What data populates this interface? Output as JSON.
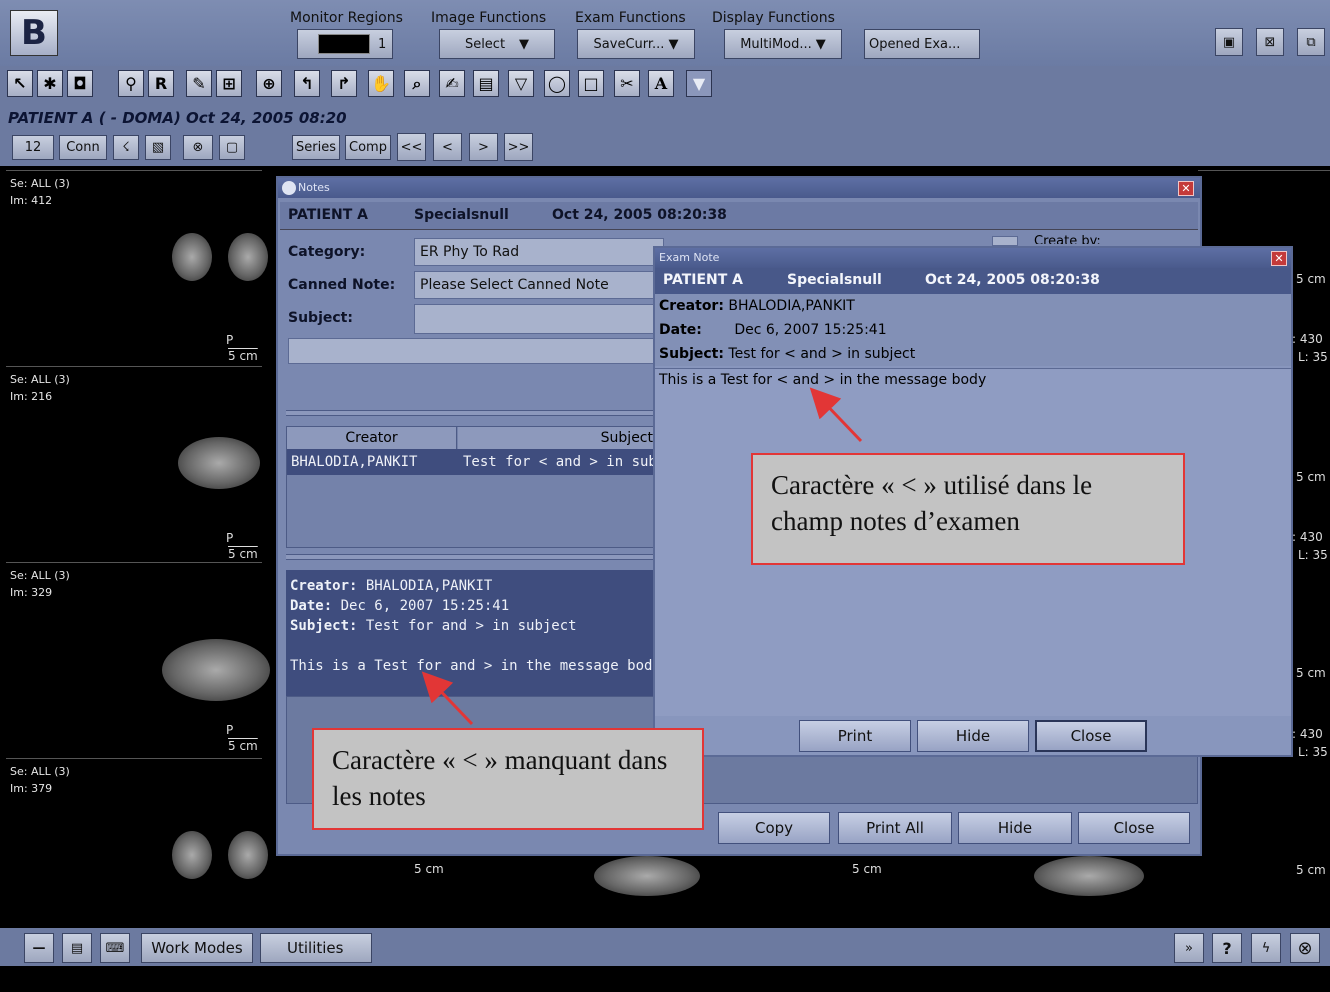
{
  "app": {
    "logo": "B"
  },
  "menus": [
    "Monitor Regions",
    "Image Functions",
    "Exam Functions",
    "Display Functions"
  ],
  "menu_controls": {
    "region_value": "1",
    "image_select": "Select",
    "exam_save": "SaveCurr...",
    "display_mode": "MultiMod...",
    "opened": "Opened Exa..."
  },
  "toolbar_labels": {
    "r": "R",
    "a": "A"
  },
  "patient_header": "PATIENT A ( - DOMA) Oct 24, 2005 08:20",
  "subtoolbar": {
    "count": "12",
    "conn": "Conn",
    "series": "Series",
    "comp": "Comp",
    "first": "<<",
    "prev": "<",
    "next": ">",
    "last": ">>"
  },
  "viewports": [
    {
      "se": "Se: ALL (3)",
      "im": "Im: 412",
      "scale": "5 cm",
      "p": "P"
    },
    {
      "se": "Se: ALL (3)",
      "im": "Im: 216",
      "scale": "5 cm",
      "p": "P"
    },
    {
      "se": "Se: ALL (3)",
      "im": "Im: 329",
      "scale": "5 cm",
      "p": "P"
    },
    {
      "se": "Se: ALL (3)",
      "im": "Im: 379",
      "scale": "5 cm",
      "p": "P"
    }
  ],
  "right_vp": {
    "scale": "5 cm",
    "w": ": 430",
    "l": "L: 35",
    "lmark": "L"
  },
  "notes": {
    "title": "Notes",
    "header": {
      "patient": "PATIENT A",
      "special": "Specialsnull",
      "date": "Oct 24, 2005 08:20:38"
    },
    "category_label": "Category:",
    "category_value": "ER Phy To Rad",
    "canned_label": "Canned Note:",
    "canned_value": "Please Select Canned Note",
    "subject_label": "Subject:",
    "create_by": "Create by:",
    "table_headers": [
      "Creator",
      "Subject"
    ],
    "row": {
      "creator": "BHALODIA,PANKIT",
      "subject": "Test  for < and > in sub"
    },
    "detail": {
      "creator_label": "Creator:",
      "creator": "BHALODIA,PANKIT",
      "date_label": "Date:",
      "date": "Dec 6, 2007 15:25:41",
      "subject_label": "Subject:",
      "subject": "Test for and > in subject",
      "body": "This is a Test for and > in the message body"
    },
    "buttons": {
      "copy": "Copy",
      "print_all": "Print All",
      "hide": "Hide",
      "close": "Close"
    }
  },
  "exam_note": {
    "title": "Exam Note",
    "header": {
      "patient": "PATIENT A",
      "special": "Specialsnull",
      "date": "Oct 24, 2005 08:20:38"
    },
    "creator_label": "Creator:",
    "creator": "BHALODIA,PANKIT",
    "date_label": "Date:",
    "date": "Dec 6, 2007 15:25:41",
    "subject_label": "Subject:",
    "subject": "Test  for < and > in subject",
    "body": "This is a Test  for < and > in the message body",
    "buttons": {
      "print": "Print",
      "hide": "Hide",
      "close": "Close"
    }
  },
  "callouts": {
    "top": "Caractère « < » utilisé dans le champ notes d’examen",
    "bottom": "Caractère « < » manquant dans les notes"
  },
  "bottom_bar": {
    "work_modes": "Work Modes",
    "utilities": "Utilities",
    "help": "?",
    "expand": "»"
  },
  "colors": {
    "panel": "#6c7aa0",
    "dialog": "#7a88b0",
    "callout_border": "#e23636",
    "arrow": "#e23636"
  }
}
